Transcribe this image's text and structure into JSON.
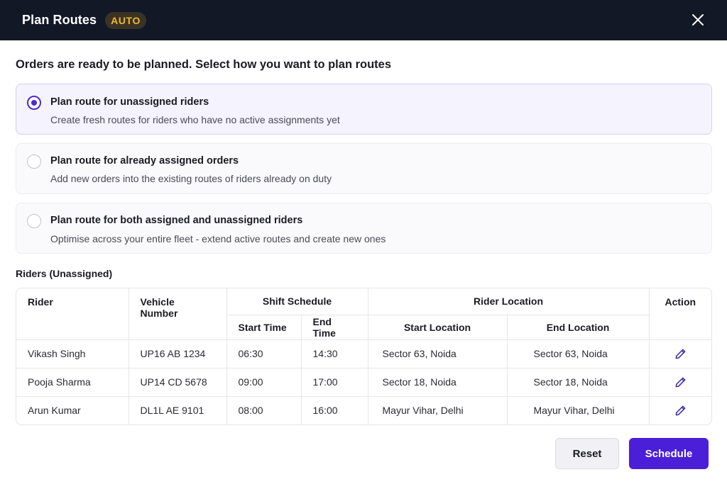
{
  "header": {
    "title": "Plan Routes",
    "badge": "AUTO"
  },
  "prompt": "Orders are ready to be planned. Select how you want to plan routes",
  "options": [
    {
      "title": "Plan route for unassigned riders",
      "description": "Create fresh routes for riders who have no active assignments yet",
      "selected": true
    },
    {
      "title": "Plan route for already assigned orders",
      "description": "Add new orders into the existing routes of riders already on duty",
      "selected": false
    },
    {
      "title": "Plan route for both assigned and unassigned riders",
      "description": "Optimise across your entire fleet - extend active routes and create new ones",
      "selected": false
    }
  ],
  "riders_section": {
    "title": "Riders (Unassigned)",
    "headers": {
      "rider": "Rider",
      "vehicle": "Vehicle Number",
      "shift": "Shift Schedule",
      "location": "Rider Location",
      "action": "Action",
      "start_time": "Start Time",
      "end_time": "End Time",
      "start_location": "Start Location",
      "end_location": "End Location"
    },
    "rows": [
      {
        "rider": "Vikash Singh",
        "vehicle": "UP16 AB 1234",
        "start_time": "06:30",
        "end_time": "14:30",
        "start_location": "Sector 63, Noida",
        "end_location": "Sector 63, Noida"
      },
      {
        "rider": "Pooja Sharma",
        "vehicle": "UP14 CD 5678",
        "start_time": "09:00",
        "end_time": "17:00",
        "start_location": "Sector 18, Noida",
        "end_location": "Sector 18, Noida"
      },
      {
        "rider": "Arun Kumar",
        "vehicle": "DL1L AE 9101",
        "start_time": "08:00",
        "end_time": "16:00",
        "start_location": "Mayur Vihar, Delhi",
        "end_location": "Mayur Vihar, Delhi"
      }
    ]
  },
  "buttons": {
    "reset": "Reset",
    "schedule": "Schedule"
  },
  "colors": {
    "header_bg": "#121826",
    "badge_text": "#f2b630",
    "accent": "#4b1fd8",
    "selected_option_bg": "#f5f3fd"
  },
  "icons": {
    "close": "close-icon",
    "edit": "pencil-icon"
  }
}
